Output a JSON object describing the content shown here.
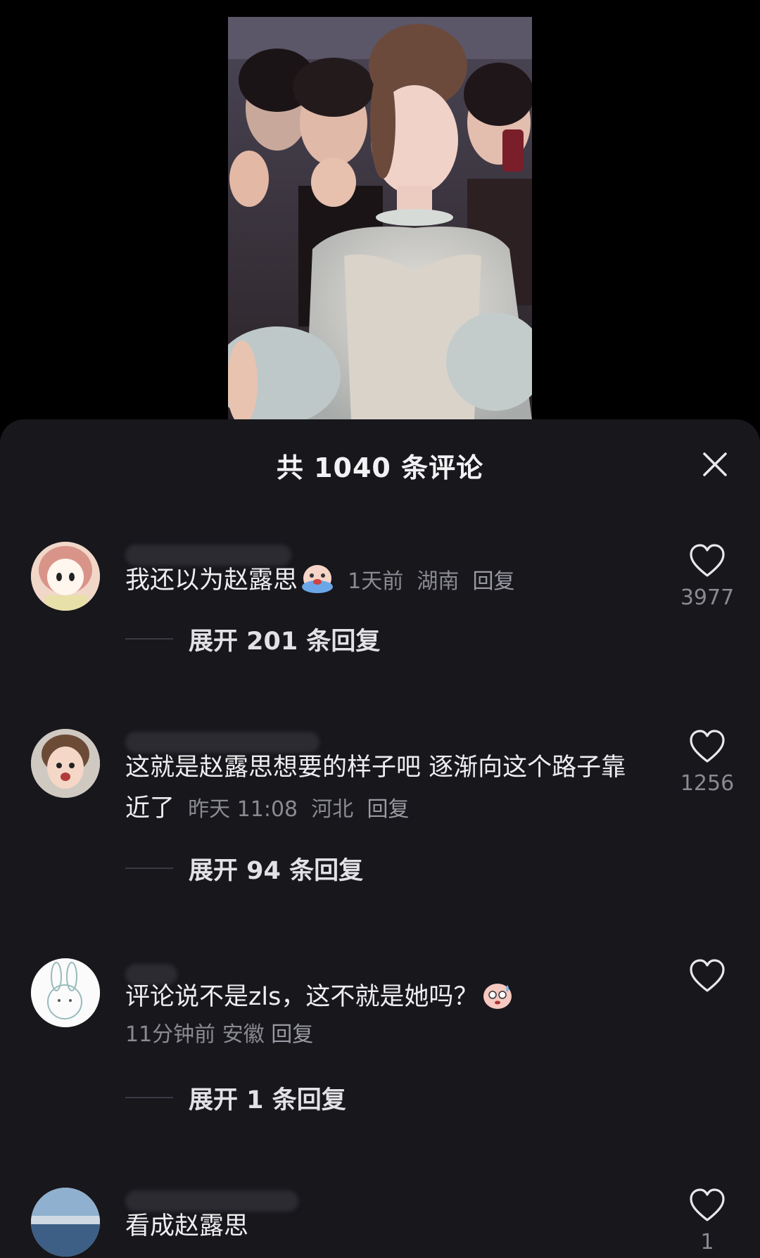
{
  "sheet": {
    "title": "共 1040 条评论"
  },
  "comments": [
    {
      "username": "",
      "text": "我还以为赵露思",
      "time": "1天前",
      "location": "湖南",
      "reply_label": "回复",
      "likes": "3977",
      "expand_label": "展开 201 条回复"
    },
    {
      "username": "",
      "text": "这就是赵露思想要的样子吧 逐渐向这个路子靠近了",
      "time": "昨天 11:08",
      "location": "河北",
      "reply_label": "回复",
      "likes": "1256",
      "expand_label": "展开 94 条回复"
    },
    {
      "username": "",
      "text": "评论说不是zls，这不就是她吗？",
      "time": "11分钟前",
      "location": "安徽",
      "reply_label": "回复",
      "likes": "",
      "expand_label": "展开 1 条回复"
    },
    {
      "username": "",
      "text": "看成赵露思",
      "likes": "1"
    }
  ],
  "colors": {
    "sheet_bg": "#17171c",
    "page_bg": "#000000",
    "muted_text": "#8a8a92"
  },
  "icons": {
    "close": "close-icon",
    "like": "heart-outline-icon",
    "emoji_cry": "crying-face-emoji-icon",
    "emoji_sweat": "sweat-face-emoji-icon"
  }
}
